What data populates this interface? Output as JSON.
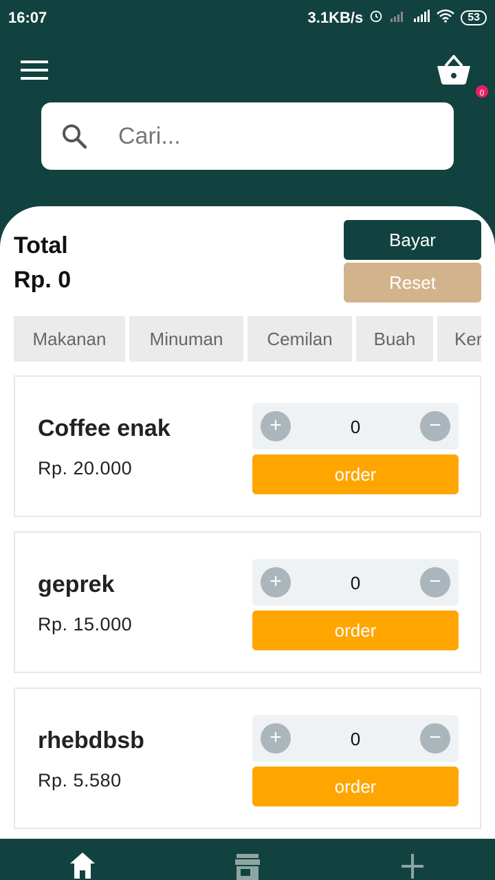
{
  "status_bar": {
    "time": "16:07",
    "net_speed": "3.1KB/s",
    "battery": "53"
  },
  "header": {
    "cart_count": "0",
    "search_placeholder": "Cari..."
  },
  "summary": {
    "total_label": "Total",
    "total_value": "Rp. 0",
    "pay_label": "Bayar",
    "reset_label": "Reset"
  },
  "categories": [
    "Makanan",
    "Minuman",
    "Cemilan",
    "Buah",
    "Ker"
  ],
  "products": [
    {
      "name": "Coffee enak",
      "price": "Rp. 20.000",
      "qty": "0",
      "order_label": "order"
    },
    {
      "name": "geprek",
      "price": "Rp. 15.000",
      "qty": "0",
      "order_label": "order"
    },
    {
      "name": "rhebdbsb",
      "price": "Rp. 5.580",
      "qty": "0",
      "order_label": "order"
    }
  ],
  "stepper": {
    "plus": "+",
    "minus": "−"
  },
  "bottom_nav": [
    {
      "icon": "home-icon"
    },
    {
      "icon": "store-icon"
    },
    {
      "icon": "plus-icon"
    }
  ],
  "colors": {
    "primary": "#11423f",
    "accent": "#ffa500",
    "reset": "#d2b48c",
    "badge": "#e91e63"
  }
}
